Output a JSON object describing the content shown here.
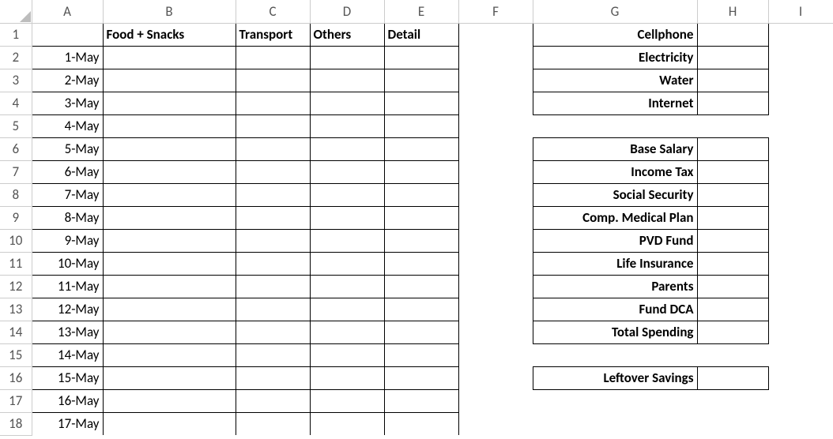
{
  "columns": [
    "A",
    "B",
    "C",
    "D",
    "E",
    "F",
    "G",
    "H",
    "I"
  ],
  "rowCount": 18,
  "headers": {
    "B": "Food + Snacks",
    "C": "Transport",
    "D": "Others",
    "E": "Detail"
  },
  "dates": [
    "1-May",
    "2-May",
    "3-May",
    "4-May",
    "5-May",
    "6-May",
    "7-May",
    "8-May",
    "9-May",
    "10-May",
    "11-May",
    "12-May",
    "13-May",
    "14-May",
    "15-May",
    "16-May",
    "17-May"
  ],
  "gLabels": {
    "1": "Cellphone",
    "2": "Electricity",
    "3": "Water",
    "4": "Internet",
    "6": "Base Salary",
    "7": "Income Tax",
    "8": "Social Security",
    "9": "Comp. Medical Plan",
    "10": "PVD Fund",
    "11": "Life Insurance",
    "12": "Parents",
    "13": "Fund DCA",
    "14": "Total Spending",
    "16": "Leftover Savings"
  }
}
